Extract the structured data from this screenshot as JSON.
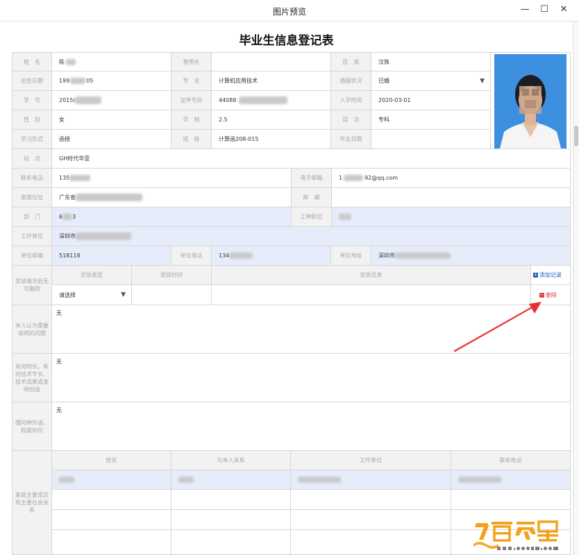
{
  "window": {
    "title": "图片预览",
    "min_glyph": "—",
    "max_glyph": "☐",
    "close_glyph": "✕"
  },
  "form": {
    "title": "毕业生信息登记表",
    "labels": {
      "name": "姓　名",
      "former_name": "曾用名",
      "ethnicity": "民　族",
      "birth": "出生日期",
      "major": "专　业",
      "marital": "婚姻状况",
      "student_no": "学　号",
      "id_no": "证件号码",
      "enroll": "入学时间",
      "gender": "性　别",
      "duration": "学　制",
      "level": "层　次",
      "study_form": "学习形式",
      "class": "班　级",
      "grad_date": "毕业日期",
      "station": "站　点",
      "phone": "联系电话",
      "email": "电子邮箱",
      "address": "家庭住址",
      "postcode": "邮　编",
      "department": "部　门",
      "job_title": "工种职位",
      "work_unit": "工作单位",
      "unit_postcode": "单位邮编",
      "unit_phone": "单位电话",
      "unit_address": "单位地址",
      "rewards": "奖惩情况若无可删除",
      "notes": "本人认为需要说明的问题",
      "skills": "有何特长、有何技术专长、技术成果或发明创造",
      "languages": "懂何种外语、程度如何",
      "family": "家庭主要成员和主要社会关系"
    },
    "values": {
      "name_prefix": "陈",
      "former_name": "",
      "ethnicity": "汉族",
      "birth_prefix": "199",
      "birth_suffix": "05",
      "major": "计算机应用技术",
      "marital": "已婚",
      "student_no_prefix": "2015(",
      "id_no_prefix": "44088",
      "enroll": "2020-03-01",
      "gender": "女",
      "duration": "2.5",
      "level": "专科",
      "study_form": "函授",
      "class": "计算函208-015",
      "grad_date": "",
      "station": "GH时代华亚",
      "phone_prefix": "135",
      "email_prefix": "1",
      "email_suffix": "92@qq.com",
      "address_prefix": "广东省",
      "postcode": "",
      "department_prefix": "6",
      "department_suffix": "3",
      "job_title": "",
      "work_unit_prefix": "深圳市",
      "unit_postcode": "518118",
      "unit_phone_prefix": "134",
      "unit_address_prefix": "深圳市",
      "notes": "无",
      "skills": "无",
      "languages": "无"
    },
    "rewards_table": {
      "headers": [
        "奖惩类型",
        "奖惩时间",
        "奖惩信息"
      ],
      "add_label": "添加记录",
      "delete_label": "删除",
      "type_placeholder": "请选择"
    },
    "family_table": {
      "headers": [
        "姓名",
        "与本人关系",
        "工作单位",
        "联系电话"
      ]
    }
  },
  "colors": {
    "label_bg": "#f2f2f2",
    "highlight_bg": "#e6ecfa",
    "arrow": "#e8312f",
    "photo_bg": "#3d8fe0"
  }
}
